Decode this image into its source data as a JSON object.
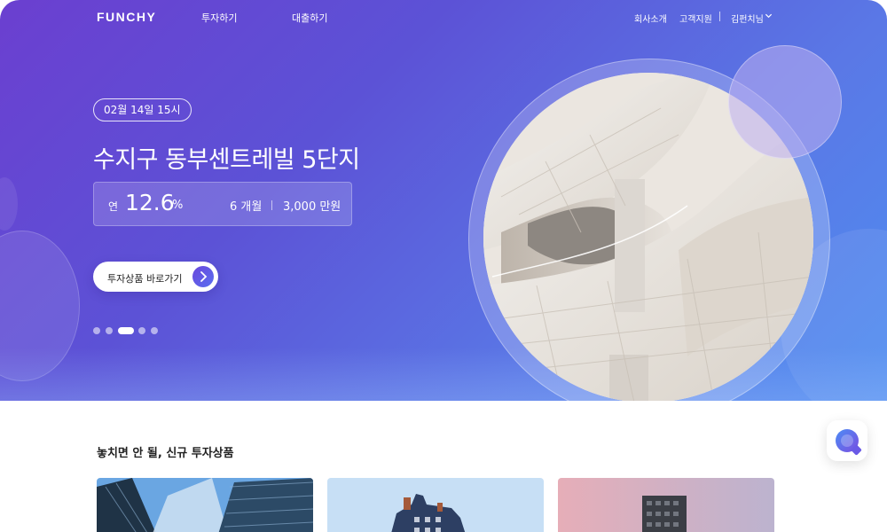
{
  "nav": {
    "logo": "FUNCHY",
    "links": [
      "투자하기",
      "대출하기"
    ],
    "right_links": [
      "회사소개",
      "고객지원"
    ],
    "user": "김펀치님",
    "user_chevron_icon": "chevron-down-icon"
  },
  "hero": {
    "date": "02월 14일 15시",
    "title": "수지구 동부센트레빌 5단지",
    "rate_prefix": "연",
    "rate": "12.6",
    "rate_unit": "%",
    "term": "6 개월",
    "amount": "3,000 만원",
    "cta_label": "투자상품 바로가기",
    "cta_icon": "chevron-right-icon",
    "slides": {
      "count": 5,
      "active_index": 2
    }
  },
  "section": {
    "title": "놓치면 안 될, 신규 투자상품"
  },
  "chat": {
    "icon": "chat-icon"
  },
  "colors": {
    "hero_gradient_start": "#6b3fd0",
    "hero_gradient_end": "#4f8df0",
    "cta_accent": "#6a47dc"
  }
}
